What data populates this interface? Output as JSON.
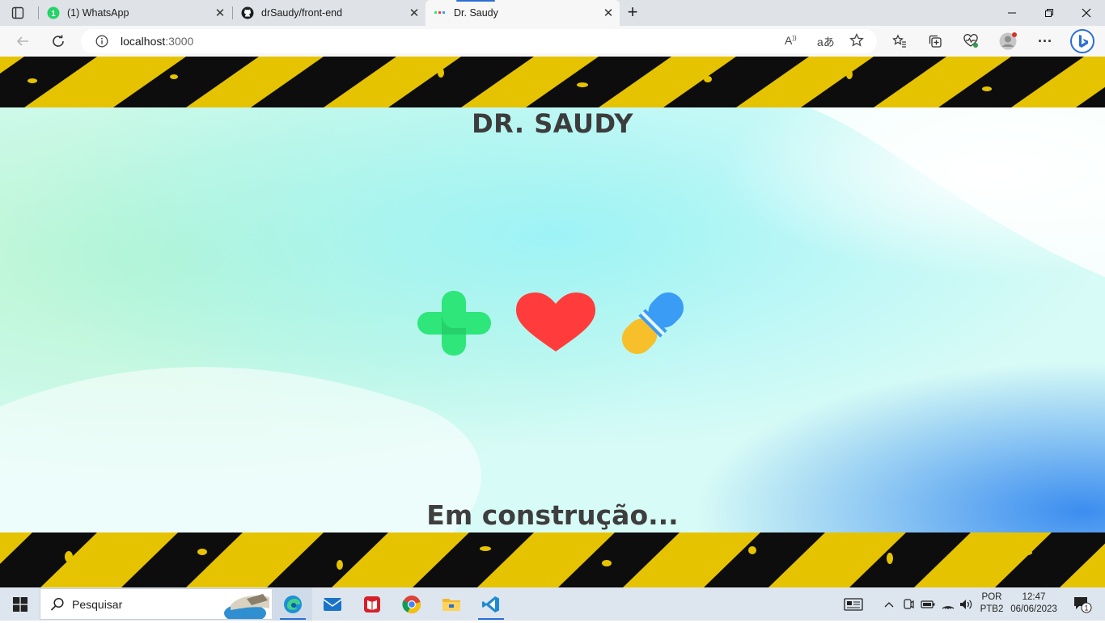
{
  "browser": {
    "tabs": [
      {
        "title": "(1) WhatsApp",
        "badge": "1",
        "icon": "whatsapp-icon"
      },
      {
        "title": "drSaudy/front-end",
        "icon": "github-icon"
      },
      {
        "title": "Dr. Saudy",
        "icon": "site-favicon",
        "active": true
      }
    ],
    "address": {
      "host": "localhost",
      "port": ":3000"
    }
  },
  "page": {
    "title": "DR. SAUDY",
    "subtitle": "Em construção...",
    "icons": [
      "medical-cross-icon",
      "heart-icon",
      "pill-capsule-icon"
    ],
    "colors": {
      "tape_yellow": "#e6c300",
      "tape_black": "#0d0d0d",
      "cross": "#2ee67a",
      "heart": "#ff3b3b",
      "pill_blue": "#3a9cf5",
      "pill_yellow": "#f7bf2a",
      "text": "#3c3c3c"
    }
  },
  "taskbar": {
    "search_label": "Pesquisar",
    "lang": {
      "line1": "POR",
      "line2": "PTB2"
    },
    "clock": {
      "time": "12:47",
      "date": "06/06/2023"
    },
    "notification_count": "1"
  }
}
